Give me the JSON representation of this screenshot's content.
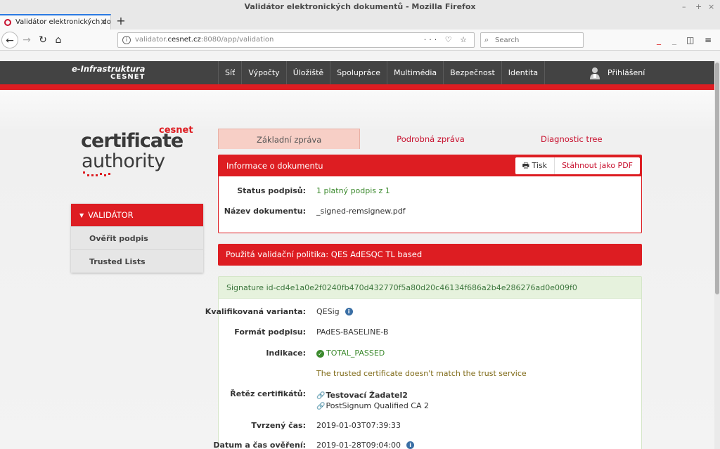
{
  "window": {
    "title": "Validátor elektronických dokumentů - Mozilla Firefox",
    "controls": [
      "–",
      "+",
      "×"
    ]
  },
  "browser": {
    "tab_title": "Validátor elektronických dokum",
    "new_tab": "+",
    "url_prefix": "validator.",
    "url_domain": "cesnet.cz",
    "url_rest": ":8080/app/validation",
    "url_icons": "···",
    "search_placeholder": "Search"
  },
  "site": {
    "logo_line1": "e-Infrastruktura",
    "logo_line2": "CESNET",
    "nav": [
      "Síť",
      "Výpočty",
      "Úložiště",
      "Spolupráce",
      "Multimédia",
      "Bezpečnost",
      "Identita"
    ],
    "login": "Přihlášení"
  },
  "ca_logo": {
    "brand": "cesnet",
    "line1": "certificate",
    "line2": "authority"
  },
  "sidebar": {
    "header": "VALIDÁTOR",
    "items": [
      "Ověřit podpis",
      "Trusted Lists"
    ]
  },
  "tabs": [
    "Základní zpráva",
    "Podrobná zpráva",
    "Diagnostic tree"
  ],
  "doc_panel": {
    "title": "Informace o dokumentu",
    "print_label": "Tisk",
    "pdf_label": "Stáhnout jako PDF",
    "status_label": "Status podpisů:",
    "status_value": "1 platný podpis z 1",
    "name_label": "Název dokumentu:",
    "name_value": "_signed-remsignew.pdf"
  },
  "policy": "Použitá validační politika: QES AdESQC TL based",
  "signature": {
    "id": "Signature id-cd4e1a0e2f0240fb470d432770f5a80d20c46134f686a2b4e286276ad0e009f0",
    "qual_label": "Kvalifikovaná varianta:",
    "qual_value": "QESig",
    "format_label": "Formát podpisu:",
    "format_value": "PAdES-BASELINE-B",
    "indication_label": "Indikace:",
    "indication_value": "TOTAL_PASSED",
    "warning": "The trusted certificate doesn't match the trust service",
    "chain_label": "Řetěz certifikátů:",
    "chain": [
      "Testovací Žadatel2",
      "PostSignum Qualified CA 2"
    ],
    "claimed_time_label": "Tvrzený čas:",
    "claimed_time_value": "2019-01-03T07:39:33",
    "validation_time_label": "Datum a čas ověření:",
    "validation_time_value": "2019-01-28T09:04:00"
  },
  "colors": {
    "brand_red": "#dd1d22",
    "header_dark": "#434343",
    "success_green": "#3c8a2e",
    "warning_olive": "#7f6a17"
  }
}
